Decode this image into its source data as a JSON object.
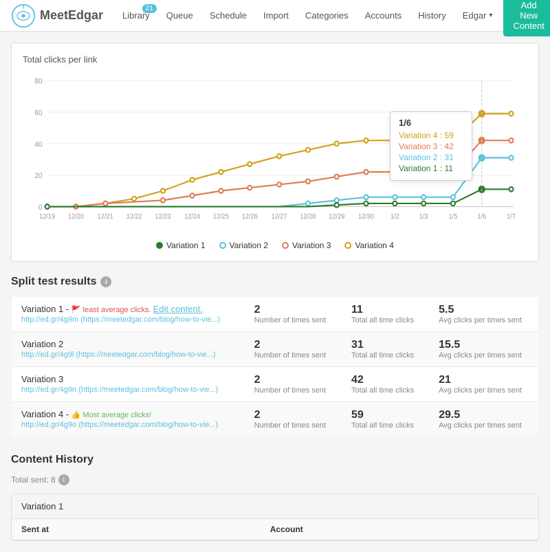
{
  "nav": {
    "logo_text": "MeetEdgar",
    "links": [
      {
        "id": "library",
        "label": "Library",
        "badge": "21",
        "active": false
      },
      {
        "id": "queue",
        "label": "Queue",
        "badge": null,
        "active": false
      },
      {
        "id": "schedule",
        "label": "Schedule",
        "badge": null,
        "active": false
      },
      {
        "id": "import",
        "label": "Import",
        "badge": null,
        "active": false
      },
      {
        "id": "categories",
        "label": "Categories",
        "badge": null,
        "active": false
      },
      {
        "id": "accounts",
        "label": "Accounts",
        "badge": null,
        "active": false
      },
      {
        "id": "history",
        "label": "History",
        "badge": null,
        "active": false
      },
      {
        "id": "edgar",
        "label": "Edgar",
        "badge": null,
        "active": false,
        "dropdown": true
      }
    ],
    "add_button": "Add New Content"
  },
  "chart": {
    "title": "Total clicks per link",
    "y_labels": [
      "80",
      "60",
      "40",
      "20",
      "0"
    ],
    "x_labels": [
      "12/19",
      "12/20",
      "12/21",
      "12/22",
      "12/23",
      "12/24",
      "12/25",
      "12/26",
      "12/27",
      "12/28",
      "12/29",
      "12/30",
      "1/2",
      "1/3",
      "1/5",
      "1/6",
      "1/7"
    ],
    "tooltip": {
      "date": "1/6",
      "rows": [
        {
          "label": "Variation 4 : 59",
          "color": "#d4a017"
        },
        {
          "label": "Variation 3 : 42",
          "color": "#e07b54"
        },
        {
          "label": "Variation 2 : 31",
          "color": "#5bc0de"
        },
        {
          "label": "Variation 1 : 11",
          "color": "#2d7a2d"
        }
      ]
    },
    "legend": [
      {
        "id": "var1",
        "label": "Variation 1",
        "color": "#2d7a2d"
      },
      {
        "id": "var2",
        "label": "Variation 2",
        "color": "#5bc0de"
      },
      {
        "id": "var3",
        "label": "Variation 3",
        "color": "#e07b54"
      },
      {
        "id": "var4",
        "label": "Variation 4",
        "color": "#d4a017"
      }
    ]
  },
  "split_test": {
    "title": "Split test results",
    "rows": [
      {
        "id": "var1",
        "name": "Variation 1 -",
        "badge": "least average clicks.",
        "badge_type": "least",
        "edit_label": "Edit content.",
        "url": "http://ed.gr/4g9m",
        "url_full": "(https://meetedgar.com/blog/how-to-vie...)",
        "sent": "2",
        "sent_label": "Number of times sent",
        "clicks": "11",
        "clicks_label": "Total all time clicks",
        "avg": "5.5",
        "avg_label": "Avg clicks per times sent"
      },
      {
        "id": "var2",
        "name": "Variation 2",
        "badge": null,
        "badge_type": null,
        "edit_label": null,
        "url": "http://ed.gr/4g9l",
        "url_full": "(https://meetedgar.com/blog/how-to-vie...)",
        "sent": "2",
        "sent_label": "Number of times sent",
        "clicks": "31",
        "clicks_label": "Total all time clicks",
        "avg": "15.5",
        "avg_label": "Avg clicks per times sent"
      },
      {
        "id": "var3",
        "name": "Variation 3",
        "badge": null,
        "badge_type": null,
        "edit_label": null,
        "url": "http://ed.gr/4g9n",
        "url_full": "(https://meetedgar.com/blog/how-to-vie...)",
        "sent": "2",
        "sent_label": "Number of times sent",
        "clicks": "42",
        "clicks_label": "Total all time clicks",
        "avg": "21",
        "avg_label": "Avg clicks per times sent"
      },
      {
        "id": "var4",
        "name": "Variation 4 -",
        "badge": "Most average clicks!",
        "badge_type": "most",
        "edit_label": null,
        "url": "http://ed.gr/4g9o",
        "url_full": "(https://meetedgar.com/blog/how-to-vie...)",
        "sent": "2",
        "sent_label": "Number of times sent",
        "clicks": "59",
        "clicks_label": "Total all time clicks",
        "avg": "29.5",
        "avg_label": "Avg clicks per times sent"
      }
    ]
  },
  "content_history": {
    "title": "Content History",
    "total_sent_label": "Total sent: 8",
    "variation_label": "Variation 1",
    "table_headers": [
      "Sent at",
      "Account"
    ]
  }
}
